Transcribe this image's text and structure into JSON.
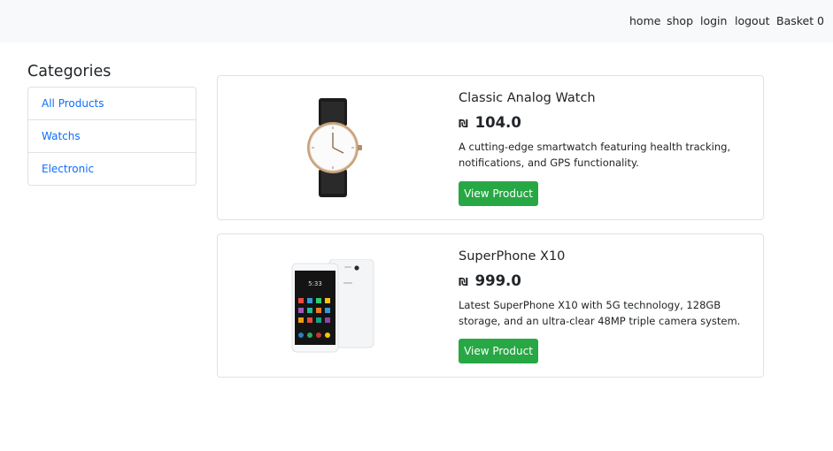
{
  "nav": {
    "home": "home",
    "shop": "shop",
    "login": "login",
    "logout": "logout",
    "basket": "Basket",
    "basket_count": "0"
  },
  "categories": {
    "title": "Categories",
    "items": [
      {
        "label": "All Products"
      },
      {
        "label": "Watchs"
      },
      {
        "label": "Electronic"
      }
    ]
  },
  "products": [
    {
      "name": "Classic Analog Watch",
      "currency": "₪",
      "price": "104.0",
      "description": "A cutting-edge smartwatch featuring health tracking, notifications, and GPS functionality.",
      "button_label": "View Product",
      "image_icon": "watch-image"
    },
    {
      "name": "SuperPhone X10",
      "currency": "₪",
      "price": "999.0",
      "description": "Latest SuperPhone X10 with 5G technology, 128GB storage, and an ultra-clear 48MP triple camera system.",
      "button_label": "View Product",
      "image_icon": "phone-image"
    }
  ],
  "colors": {
    "navbar_bg": "#f8f9fa",
    "link": "#0d6efd",
    "button": "#28a745",
    "border": "#dee2e6"
  }
}
